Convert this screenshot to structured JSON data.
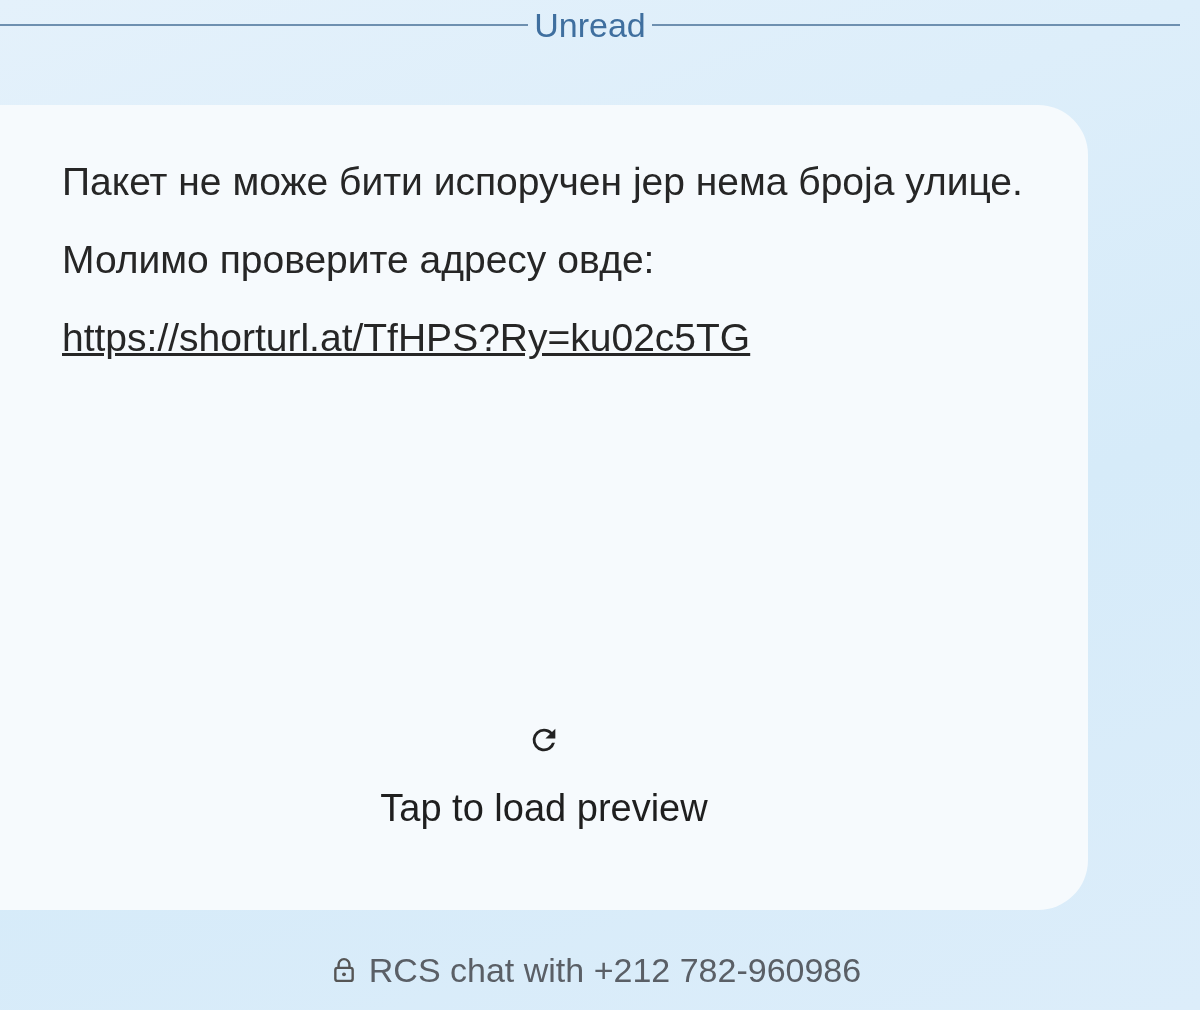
{
  "divider": {
    "label": "Unread"
  },
  "message": {
    "text": "Пакет не може бити испоручен јер нема броја улице. Молимо проверите адресу овде:",
    "link": "https://shorturl.at/TfHPS?Ry=ku02c5TG"
  },
  "preview": {
    "label": "Tap to load preview"
  },
  "footer": {
    "text": "RCS chat with +212 782-960986"
  }
}
